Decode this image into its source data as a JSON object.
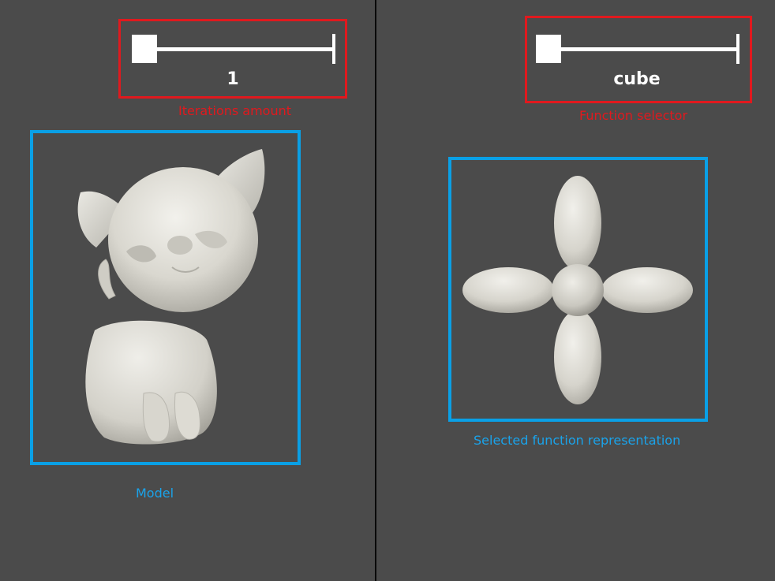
{
  "iterations": {
    "label": "Iterations amount",
    "value": "1",
    "slider_fraction": 0.0
  },
  "function_selector": {
    "label": "Function selector",
    "value": "cube",
    "slider_fraction": 0.0
  },
  "model_view": {
    "label": "Model",
    "object": "cat-model"
  },
  "function_view": {
    "label": "Selected function representation",
    "object": "four-lobe-shape"
  },
  "colors": {
    "background": "#4b4b4b",
    "divider": "#0a0a0a",
    "annotation_red": "#e0191e",
    "annotation_blue": "#0aa0e6",
    "mesh": "#e6e4dc",
    "slider": "#ffffff"
  }
}
